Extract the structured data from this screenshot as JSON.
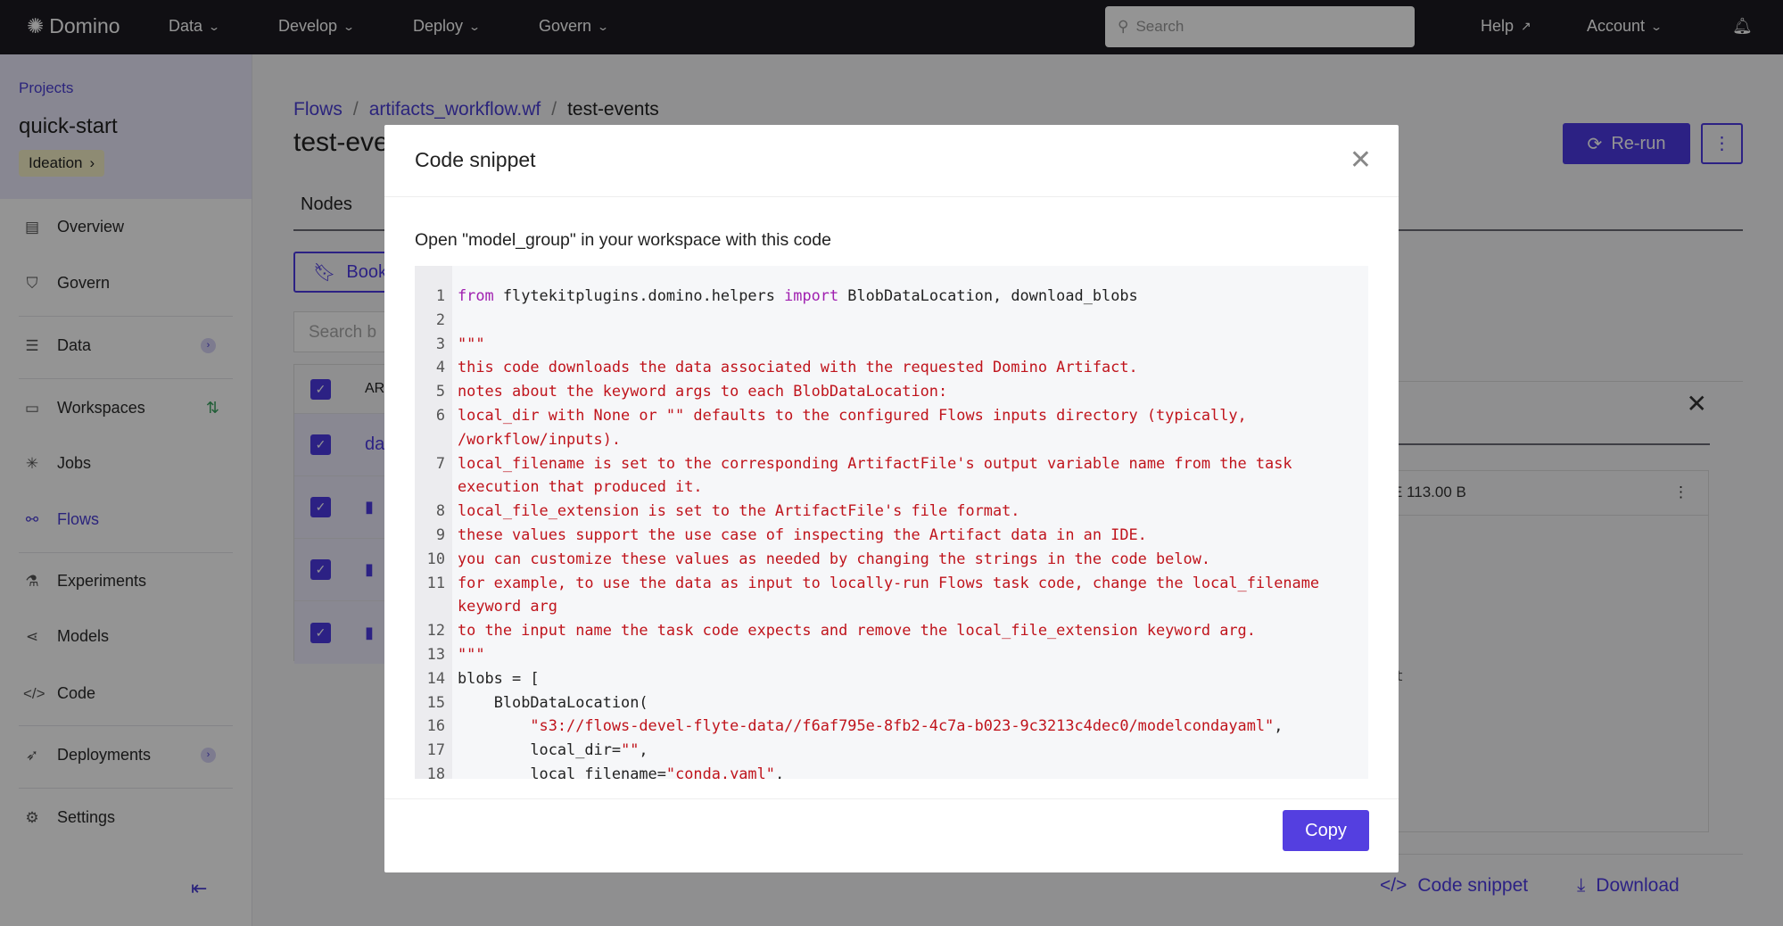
{
  "topbar": {
    "brand": "Domino",
    "nav": [
      {
        "label": "Data"
      },
      {
        "label": "Develop"
      },
      {
        "label": "Deploy"
      },
      {
        "label": "Govern"
      }
    ],
    "search_placeholder": "Search",
    "help": "Help",
    "account": "Account"
  },
  "sidebar": {
    "projects_link": "Projects",
    "project_name": "quick-start",
    "phase": "Ideation",
    "items": [
      {
        "label": "Overview",
        "icon": "document-icon"
      },
      {
        "label": "Govern",
        "icon": "shield-icon"
      },
      {
        "label": "Data",
        "icon": "database-icon"
      },
      {
        "label": "Workspaces",
        "icon": "monitor-icon"
      },
      {
        "label": "Jobs",
        "icon": "spinner-icon"
      },
      {
        "label": "Flows",
        "icon": "flows-icon"
      },
      {
        "label": "Experiments",
        "icon": "flask-icon"
      },
      {
        "label": "Models",
        "icon": "models-icon"
      },
      {
        "label": "Code",
        "icon": "code-icon"
      },
      {
        "label": "Deployments",
        "icon": "rocket-icon"
      },
      {
        "label": "Settings",
        "icon": "gear-icon"
      }
    ],
    "active": "Flows"
  },
  "page": {
    "breadcrumb": [
      "Flows",
      "artifacts_workflow.wf",
      "test-events"
    ],
    "title": "test-eve",
    "rerun": "Re-run",
    "tab": "Nodes",
    "bookmark": "Bookm",
    "search_placeholder": "Search b",
    "table_header": "ART",
    "row1": "da",
    "card_size": "E 113.00 B",
    "card_text": "t",
    "code_snippet": "Code snippet",
    "download": "Download"
  },
  "modal": {
    "title": "Code snippet",
    "description": "Open \"model_group\" in your workspace with this code",
    "copy": "Copy",
    "lines": [
      [
        {
          "t": "from",
          "c": "kw"
        },
        {
          "t": " flytekitplugins.domino.helpers "
        },
        {
          "t": "import",
          "c": "kw"
        },
        {
          "t": " BlobDataLocation, download_blobs"
        }
      ],
      [
        {
          "t": ""
        }
      ],
      [
        {
          "t": "\"\"\"",
          "c": "str"
        }
      ],
      [
        {
          "t": "this code downloads the data associated with the requested Domino Artifact.",
          "c": "str"
        }
      ],
      [
        {
          "t": "notes about the keyword args to each BlobDataLocation:",
          "c": "str"
        }
      ],
      [
        {
          "t": "local_dir with None or \"\" defaults to the configured Flows inputs directory (typically, /workflow/inputs).",
          "c": "str"
        }
      ],
      [
        {
          "t": "local_filename is set to the corresponding ArtifactFile's output variable name from the task execution that produced it.",
          "c": "str"
        }
      ],
      [
        {
          "t": "local_file_extension is set to the ArtifactFile's file format.",
          "c": "str"
        }
      ],
      [
        {
          "t": "these values support the use case of inspecting the Artifact data in an IDE.",
          "c": "str"
        }
      ],
      [
        {
          "t": "you can customize these values as needed by changing the strings in the code below.",
          "c": "str"
        }
      ],
      [
        {
          "t": "for example, to use the data as input to locally-run Flows task code, change the local_filename keyword arg",
          "c": "str"
        }
      ],
      [
        {
          "t": "to the input name the task code expects and remove the local_file_extension keyword arg.",
          "c": "str"
        }
      ],
      [
        {
          "t": "\"\"\"",
          "c": "str"
        }
      ],
      [
        {
          "t": "blobs = ["
        }
      ],
      [
        {
          "t": "    BlobDataLocation("
        }
      ],
      [
        {
          "t": "        "
        },
        {
          "t": "\"s3://flows-devel-flyte-data//f6af795e-8fb2-4c7a-b023-9c3213c4dec0/modelcondayaml\"",
          "c": "str"
        },
        {
          "t": ","
        }
      ],
      [
        {
          "t": "        local_dir="
        },
        {
          "t": "\"\"",
          "c": "str"
        },
        {
          "t": ","
        }
      ],
      [
        {
          "t": "        local_filename="
        },
        {
          "t": "\"conda.yaml\"",
          "c": "str"
        },
        {
          "t": ","
        }
      ]
    ]
  },
  "colors": {
    "primary": "#4c3ae3",
    "keyword": "#a020b0",
    "string": "#c0141c",
    "topbar": "#1c1b22"
  }
}
